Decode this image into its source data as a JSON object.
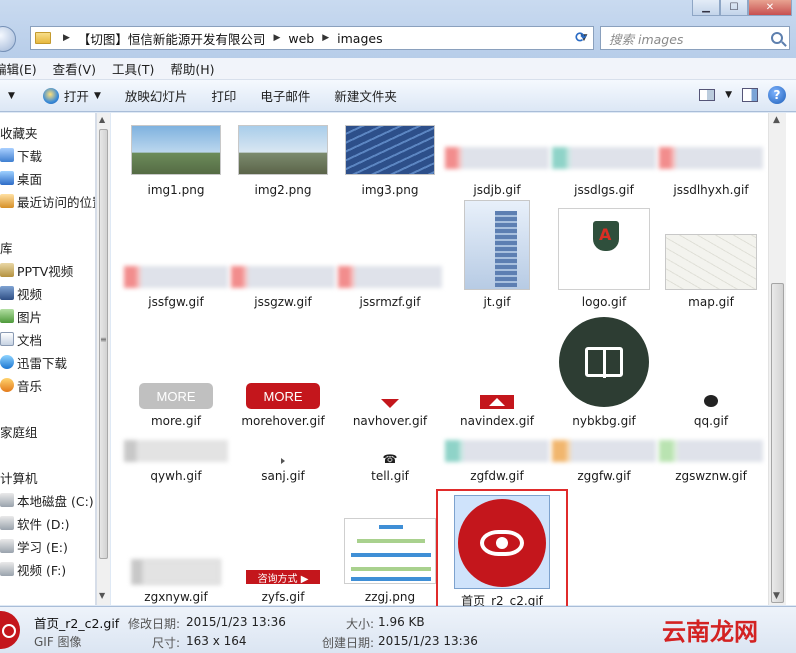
{
  "address": {
    "crumbs": [
      "【切图】恒信新能源开发有限公司",
      "web",
      "images"
    ]
  },
  "search": {
    "placeholder": "搜索 images"
  },
  "menu": [
    "编辑(E)",
    "查看(V)",
    "工具(T)",
    "帮助(H)"
  ],
  "toolbar": {
    "open": "打开",
    "slideshow": "放映幻灯片",
    "print": "打印",
    "email": "电子邮件",
    "new_folder": "新建文件夹"
  },
  "nav": {
    "favorites": "收藏夹",
    "downloads": "下载",
    "desktop": "桌面",
    "recent": "最近访问的位置",
    "libraries": "库",
    "pptv": "PPTV视频",
    "videos": "视频",
    "pictures": "图片",
    "documents": "文档",
    "thunder": "迅雷下载",
    "music": "音乐",
    "homegroup": "家庭组",
    "computer": "计算机",
    "drive_c": "本地磁盘 (C:)",
    "drive_d": "软件 (D:)",
    "drive_e": "学习 (E:)",
    "drive_f": "视频 (F:)"
  },
  "files": [
    "img1.png",
    "img2.png",
    "img3.png",
    "jsdjb.gif",
    "jssdlgs.gif",
    "jssdlhyxh.gif",
    "jssfgw.gif",
    "jssgzw.gif",
    "jssrmzf.gif",
    "jt.gif",
    "logo.gif",
    "map.gif",
    "more.gif",
    "morehover.gif",
    "navhover.gif",
    "navindex.gif",
    "nybkbg.gif",
    "qq.gif",
    "qywh.gif",
    "sanj.gif",
    "tell.gif",
    "zgfdw.gif",
    "zggfw.gif",
    "zgswznw.gif",
    "zgxnyw.gif",
    "zyfs.gif",
    "zzgj.png",
    "首页_r2_c2.gif"
  ],
  "thumb_text": {
    "more": "MORE",
    "consult": "咨询方式 ▶"
  },
  "details": {
    "name": "首页_r2_c2.gif",
    "type": "GIF 图像",
    "modified_label": "修改日期:",
    "modified": "2015/1/23 13:36",
    "size_label": "大小:",
    "size": "1.96 KB",
    "dims_label": "尺寸:",
    "dims": "163 x 164",
    "created_label": "创建日期:",
    "created": "2015/1/23 13:36"
  },
  "watermark": "云南龙网",
  "colors": {
    "accent_red": "#c4161c",
    "selection_border": "#e02b2b"
  }
}
